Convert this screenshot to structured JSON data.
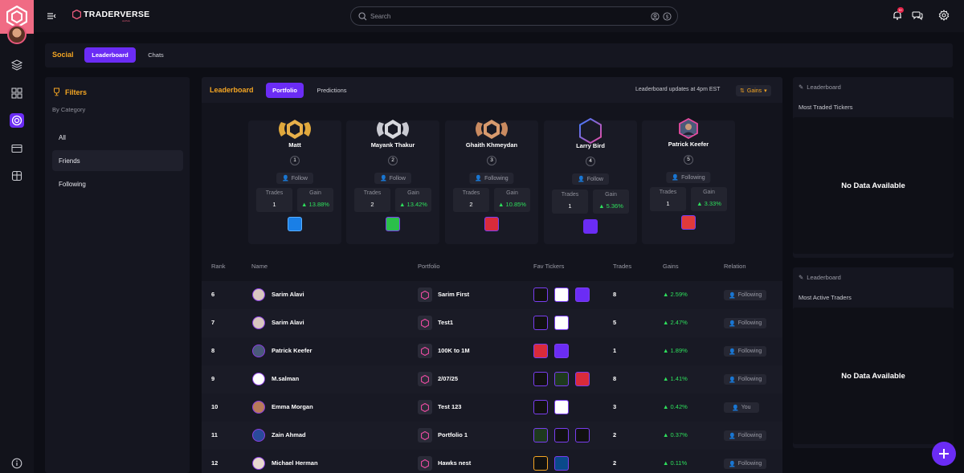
{
  "brand": {
    "name": "TRADERVERSE",
    "sub": "ALPHA"
  },
  "topbar": {
    "search_placeholder": "Search",
    "notifications_count": "9+"
  },
  "social": {
    "title": "Social",
    "tabs": [
      "Leaderboard",
      "Chats"
    ]
  },
  "filters": {
    "title": "Filters",
    "subtitle": "By Category",
    "items": [
      "All",
      "Friends",
      "Following"
    ]
  },
  "leaderboard": {
    "title": "Leaderboard",
    "tabs": [
      "Portfolio",
      "Predictions"
    ],
    "update_note": "Leaderboard updates at 4pm EST",
    "sort_label": "Gains",
    "podium": [
      {
        "name": "Matt",
        "rank": "1",
        "relation": "Follow",
        "trades_label": "Trades",
        "gain_label": "Gain",
        "trades": "1",
        "gain": "13.88%",
        "ticker": "blue-power-icon"
      },
      {
        "name": "Mayank Thakur",
        "rank": "2",
        "relation": "Follow",
        "trades_label": "Trades",
        "gain_label": "Gain",
        "trades": "2",
        "gain": "13.42%",
        "ticker": "green-leaf-icon"
      },
      {
        "name": "Ghaith Khmeydan",
        "rank": "3",
        "relation": "Following",
        "trades_label": "Trades",
        "gain_label": "Gain",
        "trades": "2",
        "gain": "10.85%",
        "ticker": "tesla-icon"
      },
      {
        "name": "Larry Bird",
        "rank": "4",
        "relation": "Follow",
        "trades_label": "Trades",
        "gain_label": "Gain",
        "trades": "1",
        "gain": "5.36%",
        "ticker": "purple-square-icon"
      },
      {
        "name": "Patrick Keefer",
        "rank": "5",
        "relation": "Following",
        "trades_label": "Trades",
        "gain_label": "Gain",
        "trades": "1",
        "gain": "3.33%",
        "ticker": "red-brand-icon"
      }
    ],
    "columns": [
      "Rank",
      "Name",
      "Portfolio",
      "Fav Tickers",
      "Trades",
      "Gains",
      "Relation"
    ],
    "rows": [
      {
        "rank": "6",
        "name": "Sarim Alavi",
        "portfolio": "Sarim First",
        "tickers": [
          "apple",
          "microsoft",
          "purple"
        ],
        "trades": "8",
        "gains": "2.59%",
        "relation": "Following"
      },
      {
        "rank": "7",
        "name": "Sarim Alavi",
        "portfolio": "Test1",
        "tickers": [
          "apple",
          "microsoft"
        ],
        "trades": "5",
        "gains": "2.47%",
        "relation": "Following"
      },
      {
        "rank": "8",
        "name": "Patrick Keefer",
        "portfolio": "100K to 1M",
        "tickers": [
          "tesla",
          "purple"
        ],
        "trades": "1",
        "gains": "1.89%",
        "relation": "Following"
      },
      {
        "rank": "9",
        "name": "M.salman",
        "portfolio": "2/07/25",
        "tickers": [
          "apple",
          "nvidia",
          "tesla"
        ],
        "trades": "8",
        "gains": "1.41%",
        "relation": "Following"
      },
      {
        "rank": "10",
        "name": "Emma Morgan",
        "portfolio": "Test 123",
        "tickers": [
          "apple",
          "microsoft"
        ],
        "trades": "3",
        "gains": "0.42%",
        "relation": "You"
      },
      {
        "rank": "11",
        "name": "Zain Ahmad",
        "portfolio": "Portfolio 1",
        "tickers": [
          "nvidia",
          "apple",
          "amazon"
        ],
        "trades": "2",
        "gains": "0.37%",
        "relation": "Following"
      },
      {
        "rank": "12",
        "name": "Michael Herman",
        "portfolio": "Hawks nest",
        "tickers": [
          "ethereum",
          "bank"
        ],
        "trades": "2",
        "gains": "0.11%",
        "relation": "Following"
      }
    ]
  },
  "right_panels": [
    {
      "label": "Leaderboard",
      "title": "Most Traded Tickers",
      "empty": "No Data Available"
    },
    {
      "label": "Leaderboard",
      "title": "Most Active Traders",
      "empty": "No Data Available"
    }
  ],
  "colors": {
    "accent": "#6b2cf5",
    "orange": "#f5a623",
    "gain": "#2ee05c",
    "brand_pink": "#f06b84"
  }
}
